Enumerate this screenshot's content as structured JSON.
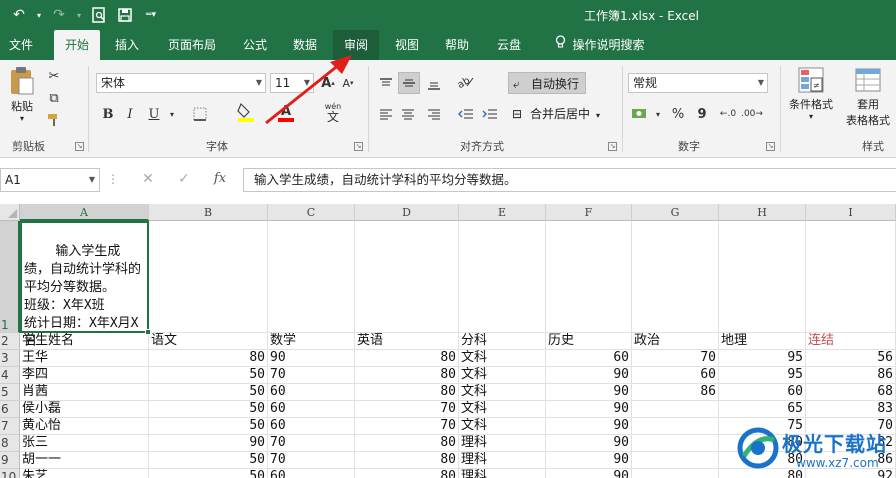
{
  "titlebar": {
    "title": "工作簿1.xlsx  -  Excel",
    "undo_icon": "undo-icon",
    "redo_icon": "redo-icon",
    "print_preview_icon": "print-preview-icon",
    "save_icon": "save-icon",
    "customize_icon": "customize-qat-icon"
  },
  "tabs": [
    {
      "label": "文件"
    },
    {
      "label": "开始"
    },
    {
      "label": "插入"
    },
    {
      "label": "页面布局"
    },
    {
      "label": "公式"
    },
    {
      "label": "数据"
    },
    {
      "label": "审阅"
    },
    {
      "label": "视图"
    },
    {
      "label": "帮助"
    },
    {
      "label": "云盘"
    },
    {
      "label": "操作说明搜索"
    }
  ],
  "ribbon": {
    "clipboard": {
      "paste_label": "粘贴",
      "group_label": "剪贴板"
    },
    "font": {
      "font_name": "宋体",
      "font_size": "11",
      "bold": "B",
      "italic": "I",
      "underline": "U",
      "group_label": "字体",
      "wen": "wén",
      "wen_char": "文",
      "grow": "A",
      "shrink": "A",
      "font_color_letter": "A"
    },
    "alignment": {
      "wrap_text": "自动换行",
      "merge_center": "合并后居中",
      "group_label": "对齐方式"
    },
    "number": {
      "format": "常规",
      "percent": "%",
      "comma": "9",
      "group_label": "数字"
    },
    "styles": {
      "conditional": "条件格式",
      "table_format_1": "套用",
      "table_format_2": "表格格式",
      "group_label": "样式",
      "group_label_visible": "样式"
    }
  },
  "formula_bar": {
    "name_box": "A1",
    "cancel": "✕",
    "enter": "✓",
    "fx": "fx",
    "content": "输入学生成绩，自动统计学科的平均分等数据。"
  },
  "columns": [
    "A",
    "B",
    "C",
    "D",
    "E",
    "F",
    "G",
    "H",
    "I"
  ],
  "rows": [
    "1",
    "2",
    "3",
    "4",
    "5",
    "6",
    "7",
    "8",
    "9",
    "10"
  ],
  "a1_text": "输入学生成绩，自动统计学科的平均分等数据。\n班级：X年X班\n统计日期：X年X月X日",
  "header_row": [
    "学生姓名",
    "语文",
    "数学",
    "英语",
    "分科",
    "历史",
    "政治",
    "地理",
    "连结"
  ],
  "data_rows": [
    [
      "王华",
      "80",
      "90",
      "80",
      "文科",
      "60",
      "70",
      "95",
      "56"
    ],
    [
      "李四",
      "50",
      "70",
      "80",
      "文科",
      "90",
      "60",
      "95",
      "86"
    ],
    [
      "肖茜",
      "50",
      "60",
      "80",
      "文科",
      "90",
      "86",
      "60",
      "68"
    ],
    [
      "侯小磊",
      "50",
      "60",
      "70",
      "文科",
      "90",
      "",
      "65",
      "83"
    ],
    [
      "黄心怡",
      "50",
      "60",
      "70",
      "文科",
      "90",
      "",
      "75",
      "70"
    ],
    [
      "张三",
      "90",
      "70",
      "80",
      "理科",
      "90",
      "",
      "80",
      "82"
    ],
    [
      "胡一一",
      "50",
      "70",
      "80",
      "理科",
      "90",
      "",
      "80",
      "86"
    ],
    [
      "朱艺",
      "50",
      "60",
      "80",
      "理科",
      "90",
      "",
      "80",
      "92"
    ]
  ],
  "watermark": {
    "name": "极光下载站",
    "url": "www.xz7.com"
  },
  "colors": {
    "excel_green": "#217346",
    "arrow_red": "#e0201b"
  }
}
